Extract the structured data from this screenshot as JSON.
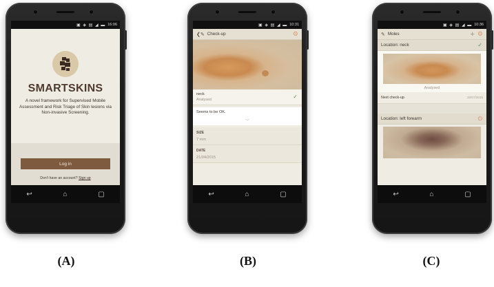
{
  "captions": [
    "(A)",
    "(B)",
    "(C)"
  ],
  "phone_a": {
    "status_time": "16:06",
    "brand": "SMARTSKINS",
    "description": "A novel framework for Supervised Mobile Assessment and Risk Triage of Skin lesions via Non-invasive Screening.",
    "login_label": "Log in",
    "no_account_text": "Don't have an account?",
    "signup_link": "Sign up"
  },
  "phone_b": {
    "status_time": "10:31",
    "title": "Check-up",
    "location": "neck",
    "status": "Analysed",
    "note": "Seems to be OK.",
    "size_label": "SIZE",
    "size_value": "7 mm",
    "date_label": "DATE",
    "date_value": "21/04/2015"
  },
  "phone_c": {
    "status_time": "10:36",
    "title": "Moles",
    "card1_location": "Location:  neck",
    "card1_status": "Analysed",
    "next_checkup_label": "Next check-up",
    "next_checkup_date": "20/07/2015",
    "card2_location": "Location:  left forearm"
  },
  "nav_icons": [
    "back-icon",
    "home-icon",
    "recents-icon"
  ]
}
